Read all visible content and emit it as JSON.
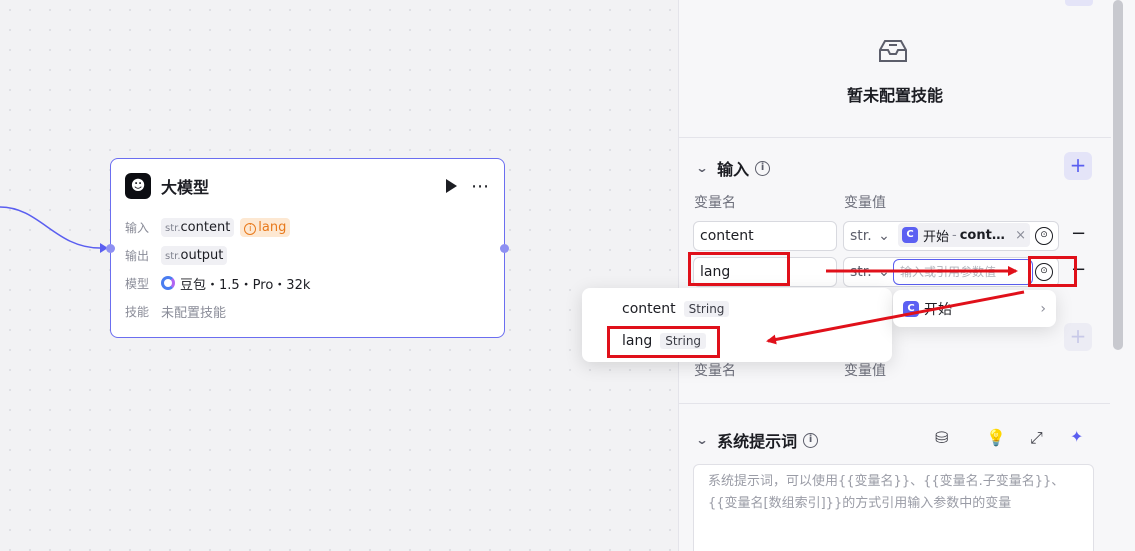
{
  "node": {
    "title": "大模型",
    "input_label": "输入",
    "input_tags": [
      {
        "prefix": "str.",
        "name": "content"
      },
      {
        "name": "lang",
        "warning": true
      }
    ],
    "output_label": "输出",
    "output_tag": {
      "prefix": "str.",
      "name": "output"
    },
    "model_label": "模型",
    "model_value": "豆包・1.5・Pro・32k",
    "skill_label": "技能",
    "skill_value": "未配置技能"
  },
  "panel": {
    "skill_empty_text": "暂未配置技能",
    "input_section": {
      "title": "输入",
      "col_name": "变量名",
      "col_value": "变量值",
      "rows": [
        {
          "name": "content",
          "type": "str.",
          "ref_source": "开始",
          "ref_sep": "-",
          "ref_field": "cont…",
          "clear": "×"
        },
        {
          "name": "lang",
          "type": "str.",
          "placeholder": "输入或引用参数值"
        }
      ]
    },
    "output_section": {
      "col_name": "变量名",
      "col_value": "变量值"
    },
    "system_prompt": {
      "title": "系统提示词",
      "placeholder": "系统提示词，可以使用{{变量名}}、{{变量名.子变量名}}、{{变量名[数组索引]}}的方式引用输入参数中的变量"
    }
  },
  "variable_dropdown": {
    "items": [
      {
        "name": "content",
        "type": "String"
      },
      {
        "name": "lang",
        "type": "String"
      }
    ]
  },
  "source_dropdown": {
    "items": [
      {
        "name": "开始"
      }
    ]
  },
  "colors": {
    "accent": "#5c60f2",
    "annotation": "#e0101a",
    "warning": "#e8791b"
  }
}
